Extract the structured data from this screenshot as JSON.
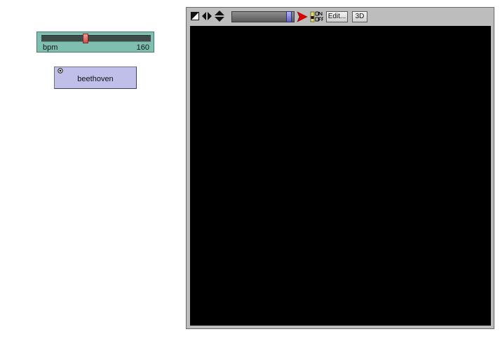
{
  "bpm_slider": {
    "label": "bpm",
    "value": "160",
    "fraction": 0.4
  },
  "beethoven_button": {
    "label": "beethoven"
  },
  "view": {
    "toolbar": {
      "edit_label": "Edit...",
      "three_d_label": "3D",
      "speed_fraction": 0.96,
      "icons": [
        "shape-toggle-icon",
        "horizontal-arrows-icon",
        "vertical-arrows-icon",
        "play-arrow-icon",
        "on-off-switch-icon"
      ]
    },
    "canvas_color": "#000000"
  },
  "colors": {
    "slider_bg": "#7fbfb0",
    "button_bg": "#c0bfe9",
    "arrow_red": "#e00000"
  }
}
